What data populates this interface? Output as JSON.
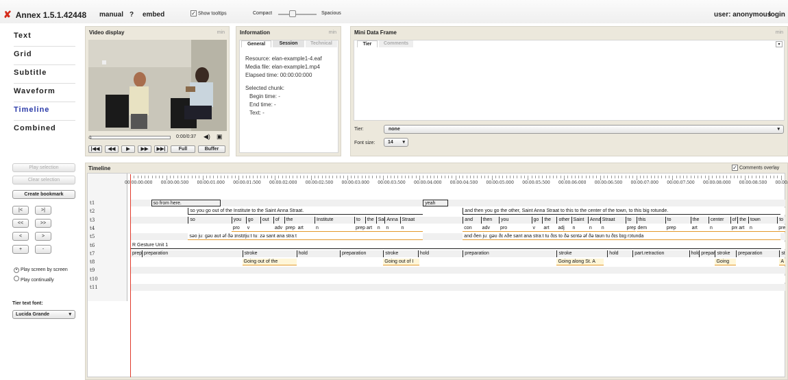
{
  "topbar": {
    "app_title": "Annex 1.5.1.42448",
    "manual": "manual",
    "help": "?",
    "embed": "embed",
    "show_tooltips": "Show tooltips",
    "compact": "Compact",
    "spacious": "Spacious",
    "user": "user: anonymous",
    "login": "login"
  },
  "nav": [
    "Text",
    "Grid",
    "Subtitle",
    "Waveform",
    "Timeline",
    "Combined"
  ],
  "nav_active": "Timeline",
  "sidebar": {
    "play_selection": "Play selection",
    "clear_selection": "Clear selection",
    "create_bookmark": "Create bookmark",
    "nav_buttons": [
      [
        "|<",
        ">|"
      ],
      [
        "<<",
        ">>"
      ],
      [
        "<",
        ">"
      ],
      [
        "+",
        "-"
      ]
    ],
    "play_screen": "Play screen by screen",
    "play_continually": "Play continually",
    "tier_font_label": "Tier text font:",
    "tier_font_value": "Lucida Grande"
  },
  "video": {
    "title": "Video display",
    "min": "min",
    "time": "0:00/0:37",
    "buttons": [
      "|◀◀",
      "◀◀",
      "▶",
      "▶▶",
      "▶▶|",
      "Full",
      "Buffer"
    ]
  },
  "information": {
    "title": "Information",
    "min": "min",
    "tabs": [
      "General",
      "Session",
      "Technical"
    ],
    "resource": "Resource:  elan-example1-4.eaf",
    "media": "Media file:  elan-example1.mp4",
    "elapsed": "Elapsed time:     00:00:00:000",
    "selected_chunk": "Selected chunk:",
    "begin": "Begin time:       -",
    "end": "End time:          -",
    "text": "Text:     -"
  },
  "mini_data": {
    "title": "Mini Data Frame",
    "min": "min",
    "tabs": [
      "Tier",
      "Comments"
    ],
    "tier_label": "Tier:",
    "tier_value": "none",
    "font_label": "Font size:",
    "font_value": "14"
  },
  "timeline": {
    "title": "Timeline",
    "comments_overlay": "Comments overlay",
    "ticks": [
      "00:00:00:000",
      "00:00:00:500",
      "00:00:01:000",
      "00:00:01:500",
      "00:00:02:000",
      "00:00:02:500",
      "00:00:03:000",
      "00:00:03:500",
      "00:00:04:000",
      "00:00:04:500",
      "00:00:05:000",
      "00:00:05:500",
      "00:00:06:000",
      "00:00:06:500",
      "00:00:07:000",
      "00:00:07:500",
      "00:00:08:000",
      "00:00:08:500",
      "00:00:09:000"
    ],
    "tiers": [
      "t1",
      "t2",
      "t3",
      "t4",
      "t5",
      "t6",
      "t7",
      "t8",
      "t9",
      "t10",
      "t11"
    ],
    "rows": [
      [
        {
          "s": 0.29,
          "e": 1.25,
          "t": "so from here.",
          "k": "box"
        },
        {
          "s": 4.05,
          "e": 4.4,
          "t": "yeah",
          "k": "box"
        }
      ],
      [
        {
          "s": 0.8,
          "e": 4.05,
          "t": "so you go out of the Institute to the Saint Anna Straat.",
          "k": "line"
        },
        {
          "s": 4.6,
          "e": 9.0,
          "t": "and then you go the other, Saint Anna Straat to this to the center of the town, to this big rotunde.",
          "k": "line"
        }
      ],
      [
        {
          "s": 0.8,
          "e": 1.4,
          "t": "so"
        },
        {
          "s": 1.4,
          "e": 1.6,
          "t": "you"
        },
        {
          "s": 1.6,
          "e": 1.8,
          "t": "go"
        },
        {
          "s": 1.8,
          "e": 1.98,
          "t": "out"
        },
        {
          "s": 1.98,
          "e": 2.13,
          "t": "of"
        },
        {
          "s": 2.13,
          "e": 2.55,
          "t": "the"
        },
        {
          "s": 2.55,
          "e": 3.1,
          "t": "Institute"
        },
        {
          "s": 3.1,
          "e": 3.25,
          "t": "to"
        },
        {
          "s": 3.25,
          "e": 3.4,
          "t": "the"
        },
        {
          "s": 3.4,
          "e": 3.52,
          "t": "Saint"
        },
        {
          "s": 3.52,
          "e": 3.73,
          "t": "Anna"
        },
        {
          "s": 3.73,
          "e": 4.05,
          "t": "Straat"
        },
        {
          "s": 4.6,
          "e": 4.85,
          "t": "and"
        },
        {
          "s": 4.85,
          "e": 5.1,
          "t": "then"
        },
        {
          "s": 5.1,
          "e": 5.55,
          "t": "you"
        },
        {
          "s": 5.55,
          "e": 5.7,
          "t": "go"
        },
        {
          "s": 5.7,
          "e": 5.9,
          "t": "the"
        },
        {
          "s": 5.9,
          "e": 6.1,
          "t": "other"
        },
        {
          "s": 6.1,
          "e": 6.33,
          "t": "Saint"
        },
        {
          "s": 6.33,
          "e": 6.5,
          "t": "Anna"
        },
        {
          "s": 6.5,
          "e": 6.85,
          "t": "Straat"
        },
        {
          "s": 6.85,
          "e": 7.0,
          "t": "to"
        },
        {
          "s": 7.0,
          "e": 7.4,
          "t": "this"
        },
        {
          "s": 7.4,
          "e": 7.75,
          "t": "to"
        },
        {
          "s": 7.75,
          "e": 8.0,
          "t": "the"
        },
        {
          "s": 8.0,
          "e": 8.3,
          "t": "center"
        },
        {
          "s": 8.3,
          "e": 8.4,
          "t": "of"
        },
        {
          "s": 8.4,
          "e": 8.55,
          "t": "the"
        },
        {
          "s": 8.55,
          "e": 8.95,
          "t": "town"
        },
        {
          "s": 8.95,
          "e": 9.1,
          "t": "to"
        },
        {
          "s": 9.1,
          "e": 9.22,
          "t": "this"
        },
        {
          "s": 9.22,
          "e": 9.5,
          "t": "big"
        }
      ],
      [
        {
          "s": 1.4,
          "e": 1.6,
          "t": "pro",
          "k": "o"
        },
        {
          "s": 1.6,
          "e": 1.98,
          "t": "v",
          "k": "o"
        },
        {
          "s": 1.98,
          "e": 2.13,
          "t": "adv",
          "k": "o"
        },
        {
          "s": 2.13,
          "e": 2.3,
          "t": "prep",
          "k": "o"
        },
        {
          "s": 2.3,
          "e": 2.55,
          "t": "art",
          "k": "o"
        },
        {
          "s": 2.55,
          "e": 3.1,
          "t": "n",
          "k": "o"
        },
        {
          "s": 3.1,
          "e": 3.25,
          "t": "prep",
          "k": "o"
        },
        {
          "s": 3.25,
          "e": 3.4,
          "t": "art",
          "k": "o"
        },
        {
          "s": 3.4,
          "e": 3.52,
          "t": "n",
          "k": "o"
        },
        {
          "s": 3.52,
          "e": 3.73,
          "t": "n",
          "k": "o"
        },
        {
          "s": 3.73,
          "e": 4.05,
          "t": "n",
          "k": "o"
        },
        {
          "s": 4.6,
          "e": 4.85,
          "t": "con",
          "k": "o"
        },
        {
          "s": 4.85,
          "e": 5.1,
          "t": "adv",
          "k": "o"
        },
        {
          "s": 5.1,
          "e": 5.55,
          "t": "pro",
          "k": "o"
        },
        {
          "s": 5.55,
          "e": 5.7,
          "t": "v",
          "k": "o"
        },
        {
          "s": 5.7,
          "e": 5.9,
          "t": "art",
          "k": "o"
        },
        {
          "s": 5.9,
          "e": 6.1,
          "t": "adj",
          "k": "o"
        },
        {
          "s": 6.1,
          "e": 6.33,
          "t": "n",
          "k": "o"
        },
        {
          "s": 6.33,
          "e": 6.5,
          "t": "n",
          "k": "o"
        },
        {
          "s": 6.5,
          "e": 6.85,
          "t": "n",
          "k": "o"
        },
        {
          "s": 6.85,
          "e": 7.0,
          "t": "prep",
          "k": "o"
        },
        {
          "s": 7.0,
          "e": 7.4,
          "t": "dem",
          "k": "o"
        },
        {
          "s": 7.4,
          "e": 7.75,
          "t": "prep",
          "k": "o"
        },
        {
          "s": 7.75,
          "e": 8.0,
          "t": "art",
          "k": "o"
        },
        {
          "s": 8.0,
          "e": 8.3,
          "t": "n",
          "k": "o"
        },
        {
          "s": 8.3,
          "e": 8.4,
          "t": "prep",
          "k": "o"
        },
        {
          "s": 8.4,
          "e": 8.55,
          "t": "art",
          "k": "o"
        },
        {
          "s": 8.55,
          "e": 8.95,
          "t": "n",
          "k": "o"
        },
        {
          "s": 8.95,
          "e": 9.1,
          "t": "prep",
          "k": "o"
        },
        {
          "s": 9.1,
          "e": 9.22,
          "t": "dem",
          "k": "o"
        },
        {
          "s": 9.22,
          "e": 9.5,
          "t": "adj",
          "k": "o"
        }
      ],
      [
        {
          "s": 0.8,
          "e": 4.05,
          "t": "səo juː gəʊ aʊt əf ðə ɪnstɪtjuːt tuː zə sant ana straːt",
          "k": "o"
        },
        {
          "s": 4.6,
          "e": 9.0,
          "t": "and ðen juː gəʊ ðɪ ʌðe sant ana straːt tu ðɪs to ðə sɛntə əf ðə taʊn tu ðɪs bɪg rɔtunda",
          "k": "o"
        }
      ],
      [
        {
          "s": 0.0,
          "e": 9.0,
          "t": "R Gesture Unit 1",
          "k": "line"
        }
      ],
      [
        {
          "s": 0.0,
          "e": 0.16,
          "t": "preparation"
        },
        {
          "s": 0.16,
          "e": 1.55,
          "t": "preparation"
        },
        {
          "s": 1.55,
          "e": 2.3,
          "t": "stroke"
        },
        {
          "s": 2.3,
          "e": 2.9,
          "t": "hold"
        },
        {
          "s": 2.9,
          "e": 3.5,
          "t": "preparation"
        },
        {
          "s": 3.5,
          "e": 3.98,
          "t": "stroke"
        },
        {
          "s": 3.98,
          "e": 4.6,
          "t": "hold"
        },
        {
          "s": 4.6,
          "e": 5.9,
          "t": "preparation"
        },
        {
          "s": 5.9,
          "e": 6.6,
          "t": "stroke"
        },
        {
          "s": 6.6,
          "e": 6.95,
          "t": "hold"
        },
        {
          "s": 6.95,
          "e": 7.73,
          "t": "part.retraction"
        },
        {
          "s": 7.73,
          "e": 7.87,
          "t": "hold"
        },
        {
          "s": 7.87,
          "e": 8.09,
          "t": "preparation"
        },
        {
          "s": 8.09,
          "e": 8.38,
          "t": "stroke"
        },
        {
          "s": 8.38,
          "e": 8.98,
          "t": "preparation"
        },
        {
          "s": 8.98,
          "e": 9.5,
          "t": "stroke"
        }
      ],
      [
        {
          "s": 1.55,
          "e": 2.3,
          "t": "Going out of the",
          "k": "ol"
        },
        {
          "s": 3.5,
          "e": 4.0,
          "t": "Going out of I",
          "k": "ol"
        },
        {
          "s": 5.9,
          "e": 6.55,
          "t": "Going along St. A",
          "k": "ol"
        },
        {
          "s": 8.09,
          "e": 8.38,
          "t": "Going",
          "k": "ol"
        },
        {
          "s": 8.98,
          "e": 9.5,
          "t": "A round",
          "k": "ol"
        }
      ],
      [],
      [],
      []
    ]
  },
  "colors": {
    "accent": "#d42a1a",
    "active_nav": "#2a3aa8",
    "panel": "#ece8dc",
    "playhead": "#e03a2a"
  }
}
